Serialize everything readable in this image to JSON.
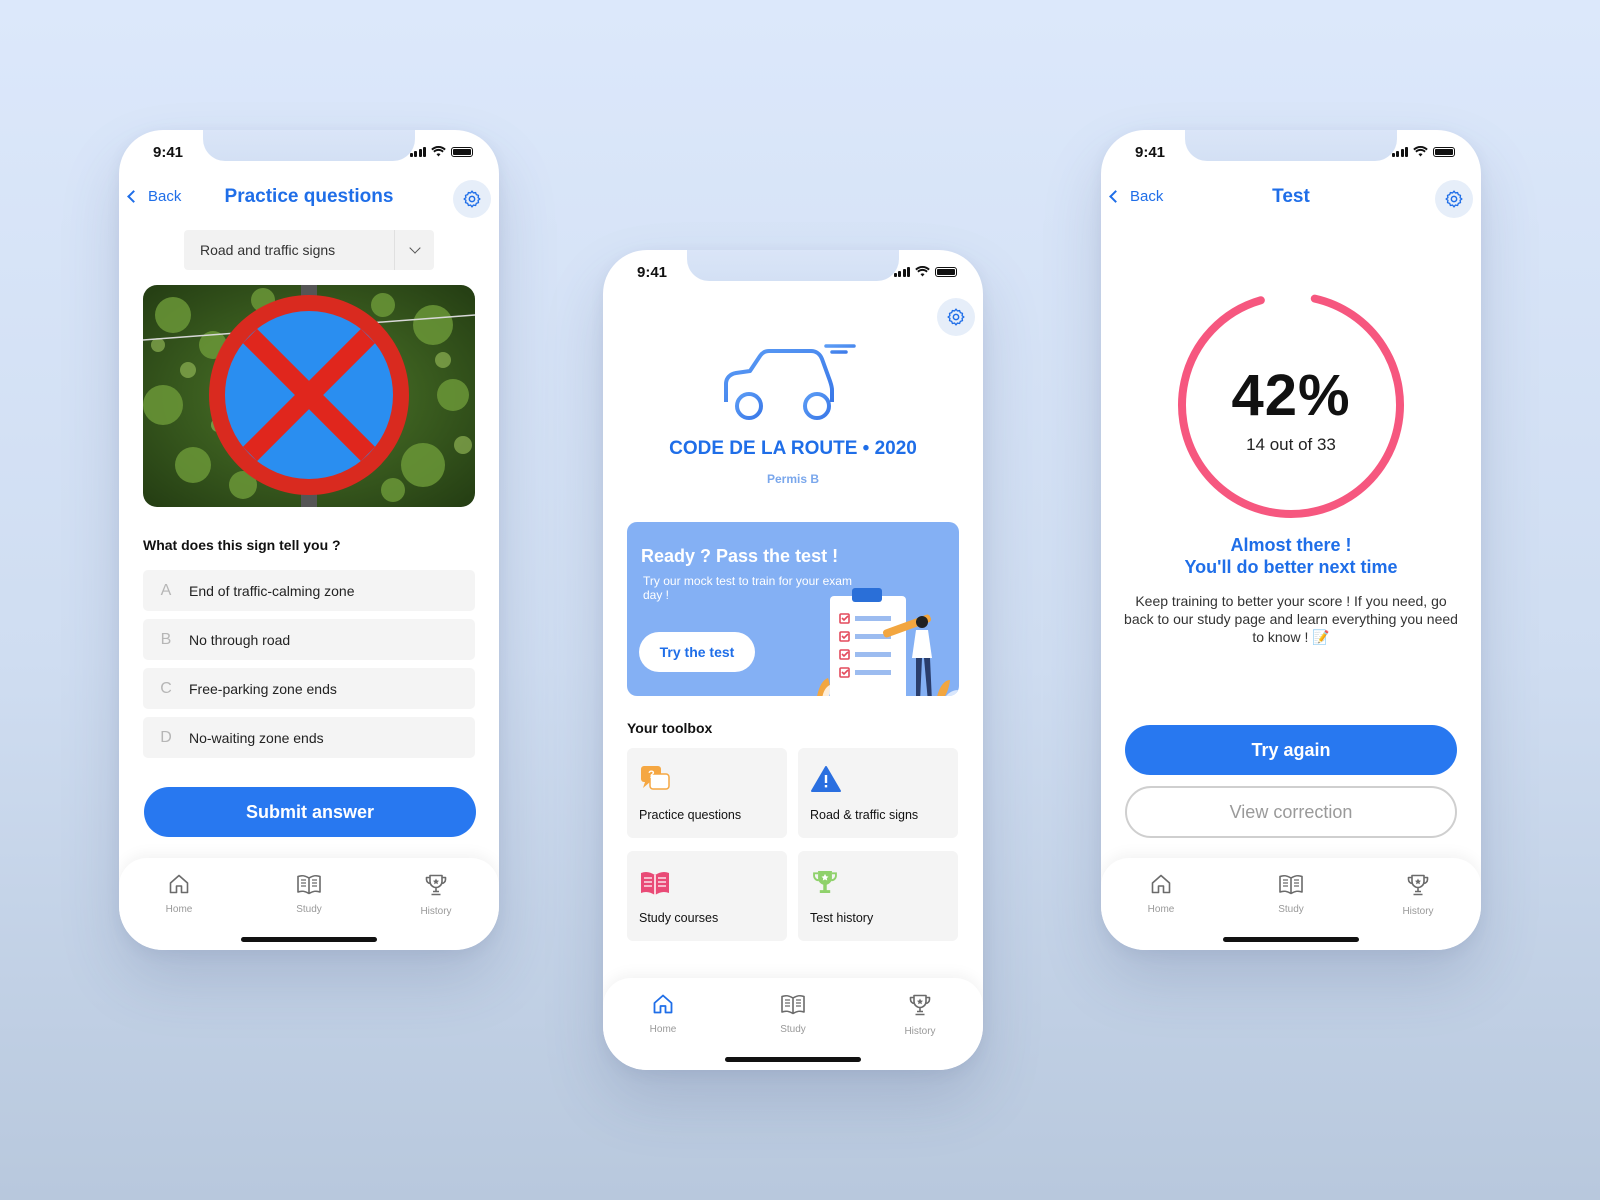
{
  "status": {
    "time": "9:41"
  },
  "tabs": [
    {
      "label": "Home",
      "icon": "home-icon"
    },
    {
      "label": "Study",
      "icon": "book-icon"
    },
    {
      "label": "History",
      "icon": "trophy-icon"
    }
  ],
  "practice": {
    "back_label": "Back",
    "title": "Practice questions",
    "category_select": {
      "value": "Road and traffic signs"
    },
    "image": "no-waiting-sign-photo",
    "question": "What does this sign tell you ?",
    "answers": [
      {
        "letter": "A",
        "text": "End of traffic-calming zone"
      },
      {
        "letter": "B",
        "text": "No through road"
      },
      {
        "letter": "C",
        "text": "Free-parking zone ends"
      },
      {
        "letter": "D",
        "text": "No-waiting zone ends"
      }
    ],
    "submit_label": "Submit answer"
  },
  "home": {
    "app_name": "CODE DE LA ROUTE • 2020",
    "license": "Permis B",
    "hero": {
      "title": "Ready ? Pass the test !",
      "text": "Try our mock test to train for your exam day !",
      "button": "Try the test"
    },
    "toolbox_title": "Your toolbox",
    "tools": [
      {
        "label": "Practice questions",
        "icon": "chat-question-icon"
      },
      {
        "label": "Road & traffic signs",
        "icon": "warning-sign-icon"
      },
      {
        "label": "Study courses",
        "icon": "open-book-icon"
      },
      {
        "label": "Test history",
        "icon": "trophy-icon"
      }
    ]
  },
  "result": {
    "back_label": "Back",
    "title": "Test",
    "score_percent": "42%",
    "score_fraction": 0.42,
    "score_detail": "14 out of 33",
    "headline_1": "Almost there !",
    "headline_2": "You'll do better next time",
    "message": "Keep training to better your score ! If you need, go back to our study page and learn everything you need to know ! 📝",
    "try_again": "Try again",
    "view_correction": "View correction"
  },
  "colors": {
    "accent": "#1f6ee8",
    "primary_button": "#2878f0",
    "hero_card": "#84b0f4",
    "score_ring": "#f6577f"
  }
}
